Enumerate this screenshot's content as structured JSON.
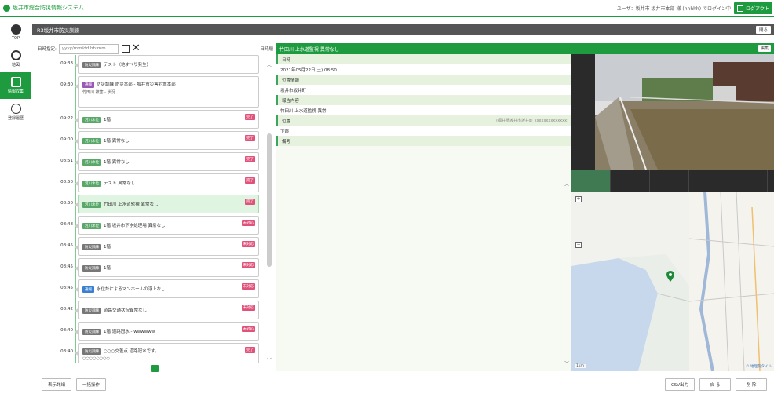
{
  "app": {
    "title": "坂井市総合防災情報システム"
  },
  "header": {
    "user_info": "ユーザ：坂井市 坂井市本部 様 (hhhhh) でログイン中",
    "logout_label": "ログアウト"
  },
  "nav": [
    {
      "label": "TOP",
      "icon": "globe-icon"
    },
    {
      "label": "地図",
      "icon": "map-icon"
    },
    {
      "label": "情報収集",
      "icon": "edit-icon",
      "active": true
    },
    {
      "label": "登録履歴",
      "icon": "history-icon"
    }
  ],
  "page": {
    "title": "R3坂井市防災訓練",
    "close_label": "閉る"
  },
  "filter": {
    "label": "日時指定:",
    "placeholder": "yyyy/mm/dd hh:mm",
    "sort_label": "日時順"
  },
  "timeline": [
    {
      "time": "09:33",
      "tag": "防災訓練",
      "tag_color": "gray",
      "text": "テスト（地すべり発生）",
      "badge": ""
    },
    {
      "time": "09:30",
      "tag": "通報",
      "tag_color": "purple",
      "text": "防災訓練 防災本部 - 坂井市災害対策本部",
      "sub": "竹田川 被害 - 状況",
      "badge": ""
    },
    {
      "time": "09:22",
      "tag": "河川水位",
      "tag_color": "green",
      "text": "1階",
      "badge": "完了"
    },
    {
      "time": "09:00",
      "tag": "河川水位",
      "tag_color": "green",
      "text": "1階 異常なし",
      "badge": "完了"
    },
    {
      "time": "08:51",
      "tag": "河川水位",
      "tag_color": "green",
      "text": "1階 異常なし",
      "badge": "完了"
    },
    {
      "time": "08:50",
      "tag": "河川水位",
      "tag_color": "green",
      "text": "テスト 異常なし",
      "badge": "完了"
    },
    {
      "time": "08:50",
      "tag": "河川水位",
      "tag_color": "green",
      "text": "竹田川 上水道監視 異常なし",
      "badge": "完了",
      "selected": true
    },
    {
      "time": "08:48",
      "tag": "河川水位",
      "tag_color": "green",
      "text": "1階 坂井市下水処理場 異常なし",
      "badge": "未対応"
    },
    {
      "time": "08:45",
      "tag": "防災訓練",
      "tag_color": "gray",
      "text": "1階",
      "badge": "未対応"
    },
    {
      "time": "08:45",
      "tag": "防災訓練",
      "tag_color": "gray",
      "text": "1階",
      "badge": "未対応"
    },
    {
      "time": "08:45",
      "tag": "通報",
      "tag_color": "blue",
      "text": "水位計によるマンホールの浮上なし",
      "badge": "未対応"
    },
    {
      "time": "08:42",
      "tag": "防災訓練",
      "tag_color": "gray",
      "text": "道路交通状況異常なし",
      "badge": "未対応"
    },
    {
      "time": "08:40",
      "tag": "防災訓練",
      "tag_color": "gray",
      "text": "1階 道路冠水 - wwwwww",
      "badge": "未対応"
    },
    {
      "time": "08:40",
      "tag": "防災訓練",
      "tag_color": "gray",
      "text": "○○○交差点 道路冠水です。",
      "sub": "○○○○○○○○",
      "badge": "完了"
    }
  ],
  "detail": {
    "header": "竹田川 上水道監視 異常なし",
    "edit_label": "編集",
    "rows": [
      {
        "type": "h",
        "text": "日時"
      },
      {
        "type": "v",
        "text": "2021年05月22日(土) 08:50"
      },
      {
        "type": "h",
        "text": "位置情報"
      },
      {
        "type": "v",
        "text": "坂井市坂井町"
      },
      {
        "type": "h",
        "text": "報告内容"
      },
      {
        "type": "v",
        "text": "竹田川 上水道監視 異常"
      },
      {
        "type": "h",
        "text": "位置",
        "right": "(福井県坂井市坂井町 xxxxxxxxxxxxxx)"
      },
      {
        "type": "v",
        "text": "下部"
      },
      {
        "type": "h",
        "text": "備考"
      }
    ]
  },
  "map": {
    "scale": "1km",
    "attribution": "© 地理院タイル"
  },
  "bottom": {
    "buttons_left": [
      "表示詳細",
      "一括操作"
    ],
    "buttons_right": [
      "CSV出力",
      "戻 る",
      "削 除"
    ]
  },
  "colors": {
    "accent": "#1d9b3e",
    "badge": "#e0527a"
  }
}
